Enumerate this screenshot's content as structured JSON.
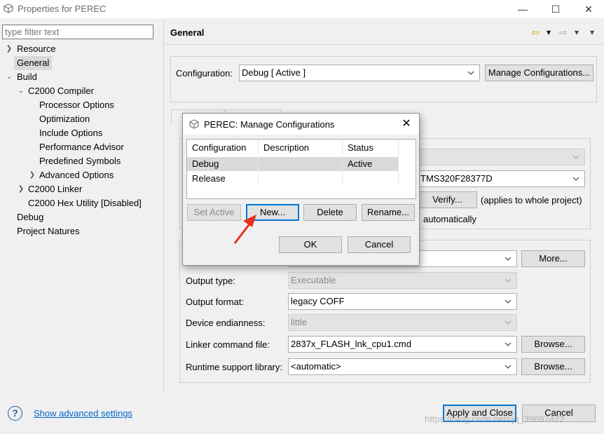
{
  "window": {
    "title": "Properties for PEREC",
    "minimize_glyph": "—",
    "maximize_glyph": "☐",
    "close_glyph": "✕"
  },
  "sidebar": {
    "filter_placeholder": "type filter text",
    "items": [
      {
        "label": "Resource"
      },
      {
        "label": "General"
      },
      {
        "label": "Build"
      },
      {
        "label": "C2000 Compiler"
      },
      {
        "label": "Processor Options"
      },
      {
        "label": "Optimization"
      },
      {
        "label": "Include Options"
      },
      {
        "label": "Performance Advisor"
      },
      {
        "label": "Predefined Symbols"
      },
      {
        "label": "Advanced Options"
      },
      {
        "label": "C2000 Linker"
      },
      {
        "label": "C2000 Hex Utility  [Disabled]"
      },
      {
        "label": "Debug"
      },
      {
        "label": "Project Natures"
      }
    ]
  },
  "header": {
    "title": "General",
    "back_glyph": "⇦",
    "forward_glyph": "⇨",
    "dropdown_glyph": "▾"
  },
  "configuration": {
    "label": "Configuration:",
    "value": "Debug  [ Active ]",
    "manage_button": "Manage Configurations..."
  },
  "device": {
    "variant_value": "TMS320F28377D",
    "verify_button": "Verify...",
    "applies_text": "(applies to whole project)",
    "automatically_text": "automatically"
  },
  "project": {
    "more_button": "More...",
    "output_type_label": "Output type:",
    "output_type_value": "Executable",
    "output_format_label": "Output format:",
    "output_format_value": "legacy COFF",
    "endianness_label": "Device endianness:",
    "endianness_value": "little",
    "linker_cmd_label": "Linker command file:",
    "linker_cmd_value": "2837x_FLASH_lnk_cpu1.cmd",
    "runtime_lib_label": "Runtime support library:",
    "runtime_lib_value": "<automatic>",
    "browse_label": "Browse..."
  },
  "footer": {
    "help_glyph": "?",
    "advanced_link": "Show advanced settings",
    "apply_close_button": "Apply and Close",
    "cancel_button": "Cancel"
  },
  "dialog": {
    "title": "PEREC: Manage Configurations",
    "close_glyph": "✕",
    "columns": [
      "Configuration",
      "Description",
      "Status"
    ],
    "rows": [
      {
        "configuration": "Debug",
        "description": "",
        "status": "Active"
      },
      {
        "configuration": "Release",
        "description": "",
        "status": ""
      }
    ],
    "set_active_button": "Set Active",
    "new_button": "New...",
    "delete_button": "Delete",
    "rename_button": "Rename...",
    "ok_button": "OK",
    "cancel_button": "Cancel"
  },
  "colors": {
    "accent": "#0078d7",
    "annotation_arrow": "#e8301c",
    "link": "#0066cc"
  },
  "watermark": "https://blog.csdn.net/qq_39697422"
}
